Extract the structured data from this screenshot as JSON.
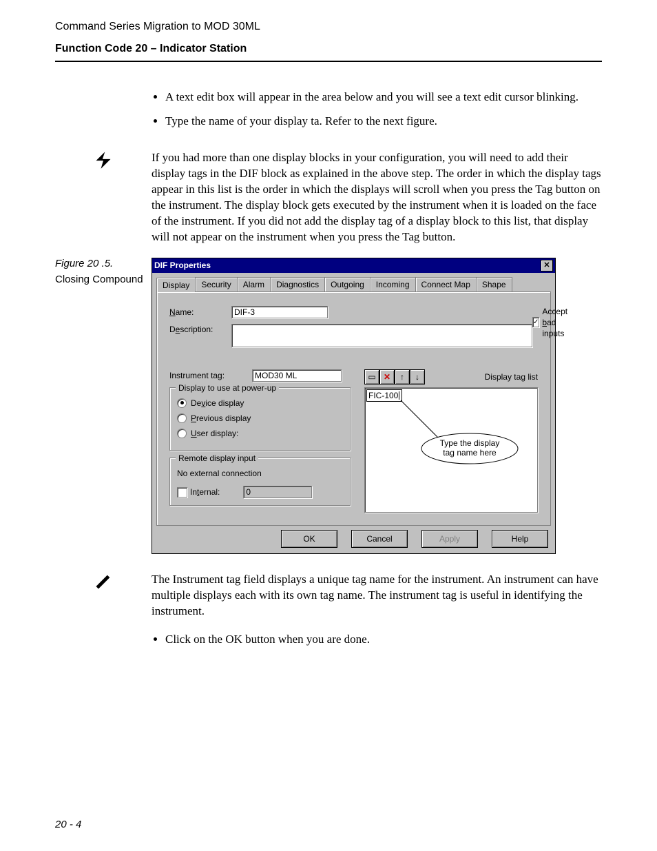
{
  "header": {
    "doc_title": "Command Series Migration to MOD 30ML",
    "section_title": "Function Code 20 – Indicator Station"
  },
  "bullets_top": [
    "A text edit box will appear in the area below and you will see a text edit cursor blinking.",
    "Type the name of your display ta. Refer to the next figure."
  ],
  "note_lightning": "If you had more than one display blocks in your configuration, you will need to add their display tags in the DIF block as explained in the above step. The order in which the display tags appear in this list is the order in which the displays will scroll when you press the Tag button on the instrument. The display block gets executed by the instrument when it is loaded on the face of the instrument. If you did not add the display tag of a display block to this list, that display will not appear on the instrument when you press the Tag button.",
  "figure": {
    "number": "Figure 20 .5.",
    "caption": "Closing Compound"
  },
  "dialog": {
    "title": "DIF Properties",
    "tabs": [
      "Display",
      "Security",
      "Alarm",
      "Diagnostics",
      "Outgoing",
      "Incoming",
      "Connect Map",
      "Shape"
    ],
    "active_tab": "Display",
    "name_label": "Name:",
    "name_value": "DIF-3",
    "accept_bad_label": "Accept bad inputs",
    "accept_bad_checked": true,
    "description_label": "Description:",
    "instrument_tag_label": "Instrument tag:",
    "instrument_tag_value": "MOD30 ML",
    "display_tag_list_label": "Display tag list",
    "powerup_group": "Display to use at power-up",
    "radio_device": "Device display",
    "radio_previous": "Previous display",
    "radio_user": "User display:",
    "remote_group": "Remote display input",
    "remote_text": "No external connection",
    "internal_label": "Internal:",
    "internal_value": "0",
    "tag_edit_value": "FIC-100",
    "callout_line1": "Type the display",
    "callout_line2": "tag name here",
    "buttons": {
      "ok": "OK",
      "cancel": "Cancel",
      "apply": "Apply",
      "help": "Help"
    }
  },
  "note_pencil": "The Instrument tag field displays a unique tag name for the instrument. An instrument can have multiple displays each with its own tag name.  The instrument tag is useful in identifying the instrument.",
  "bullets_bottom": [
    "Click on the OK button when you are done."
  ],
  "page_number": "20 - 4"
}
